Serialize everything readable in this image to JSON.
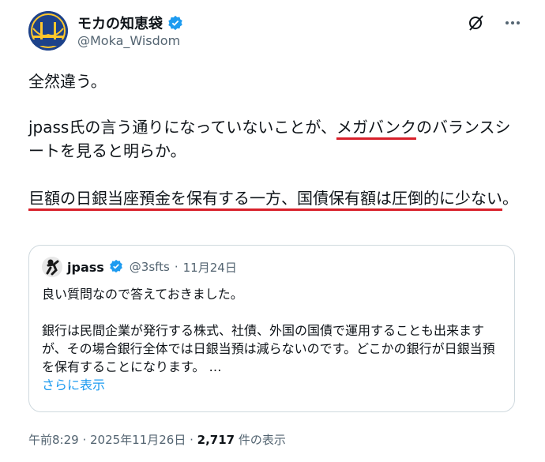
{
  "author": {
    "display_name": "モカの知恵袋",
    "handle": "@Moka_Wisdom"
  },
  "post": {
    "line1": "全然違う。",
    "para2_a": "jpass氏の言う通りになっていないことが、",
    "para2_hl": "メガバンク",
    "para2_b": "のバランスシートを見ると明らか。",
    "para3_hl": "巨額の日銀当座預金を保有する一方、国債保有額は圧倒的に少ない",
    "para3_end": "。"
  },
  "quote": {
    "name": "jpass",
    "handle": "@3sfts",
    "sep": "·",
    "date": "11月24日",
    "line1": "良い質問なので答えておきました。",
    "line2": "銀行は民間企業が発行する株式、社債、外国の国債で運用することも出来ますが、その場合銀行全体では日銀当預は減らないのです。どこかの銀行が日銀当預を保有することになります。 …",
    "more": "さらに表示"
  },
  "footer": {
    "time": "午前8:29 · 2025年11月26日 · ",
    "views": "2,717",
    "views_label": " 件の表示"
  },
  "colors": {
    "underline": "#d8202a",
    "verified": "#1d9bf0",
    "link": "#1d9bf0"
  },
  "icons": [
    "verified-badge-icon",
    "grok-icon",
    "more-options-icon"
  ]
}
